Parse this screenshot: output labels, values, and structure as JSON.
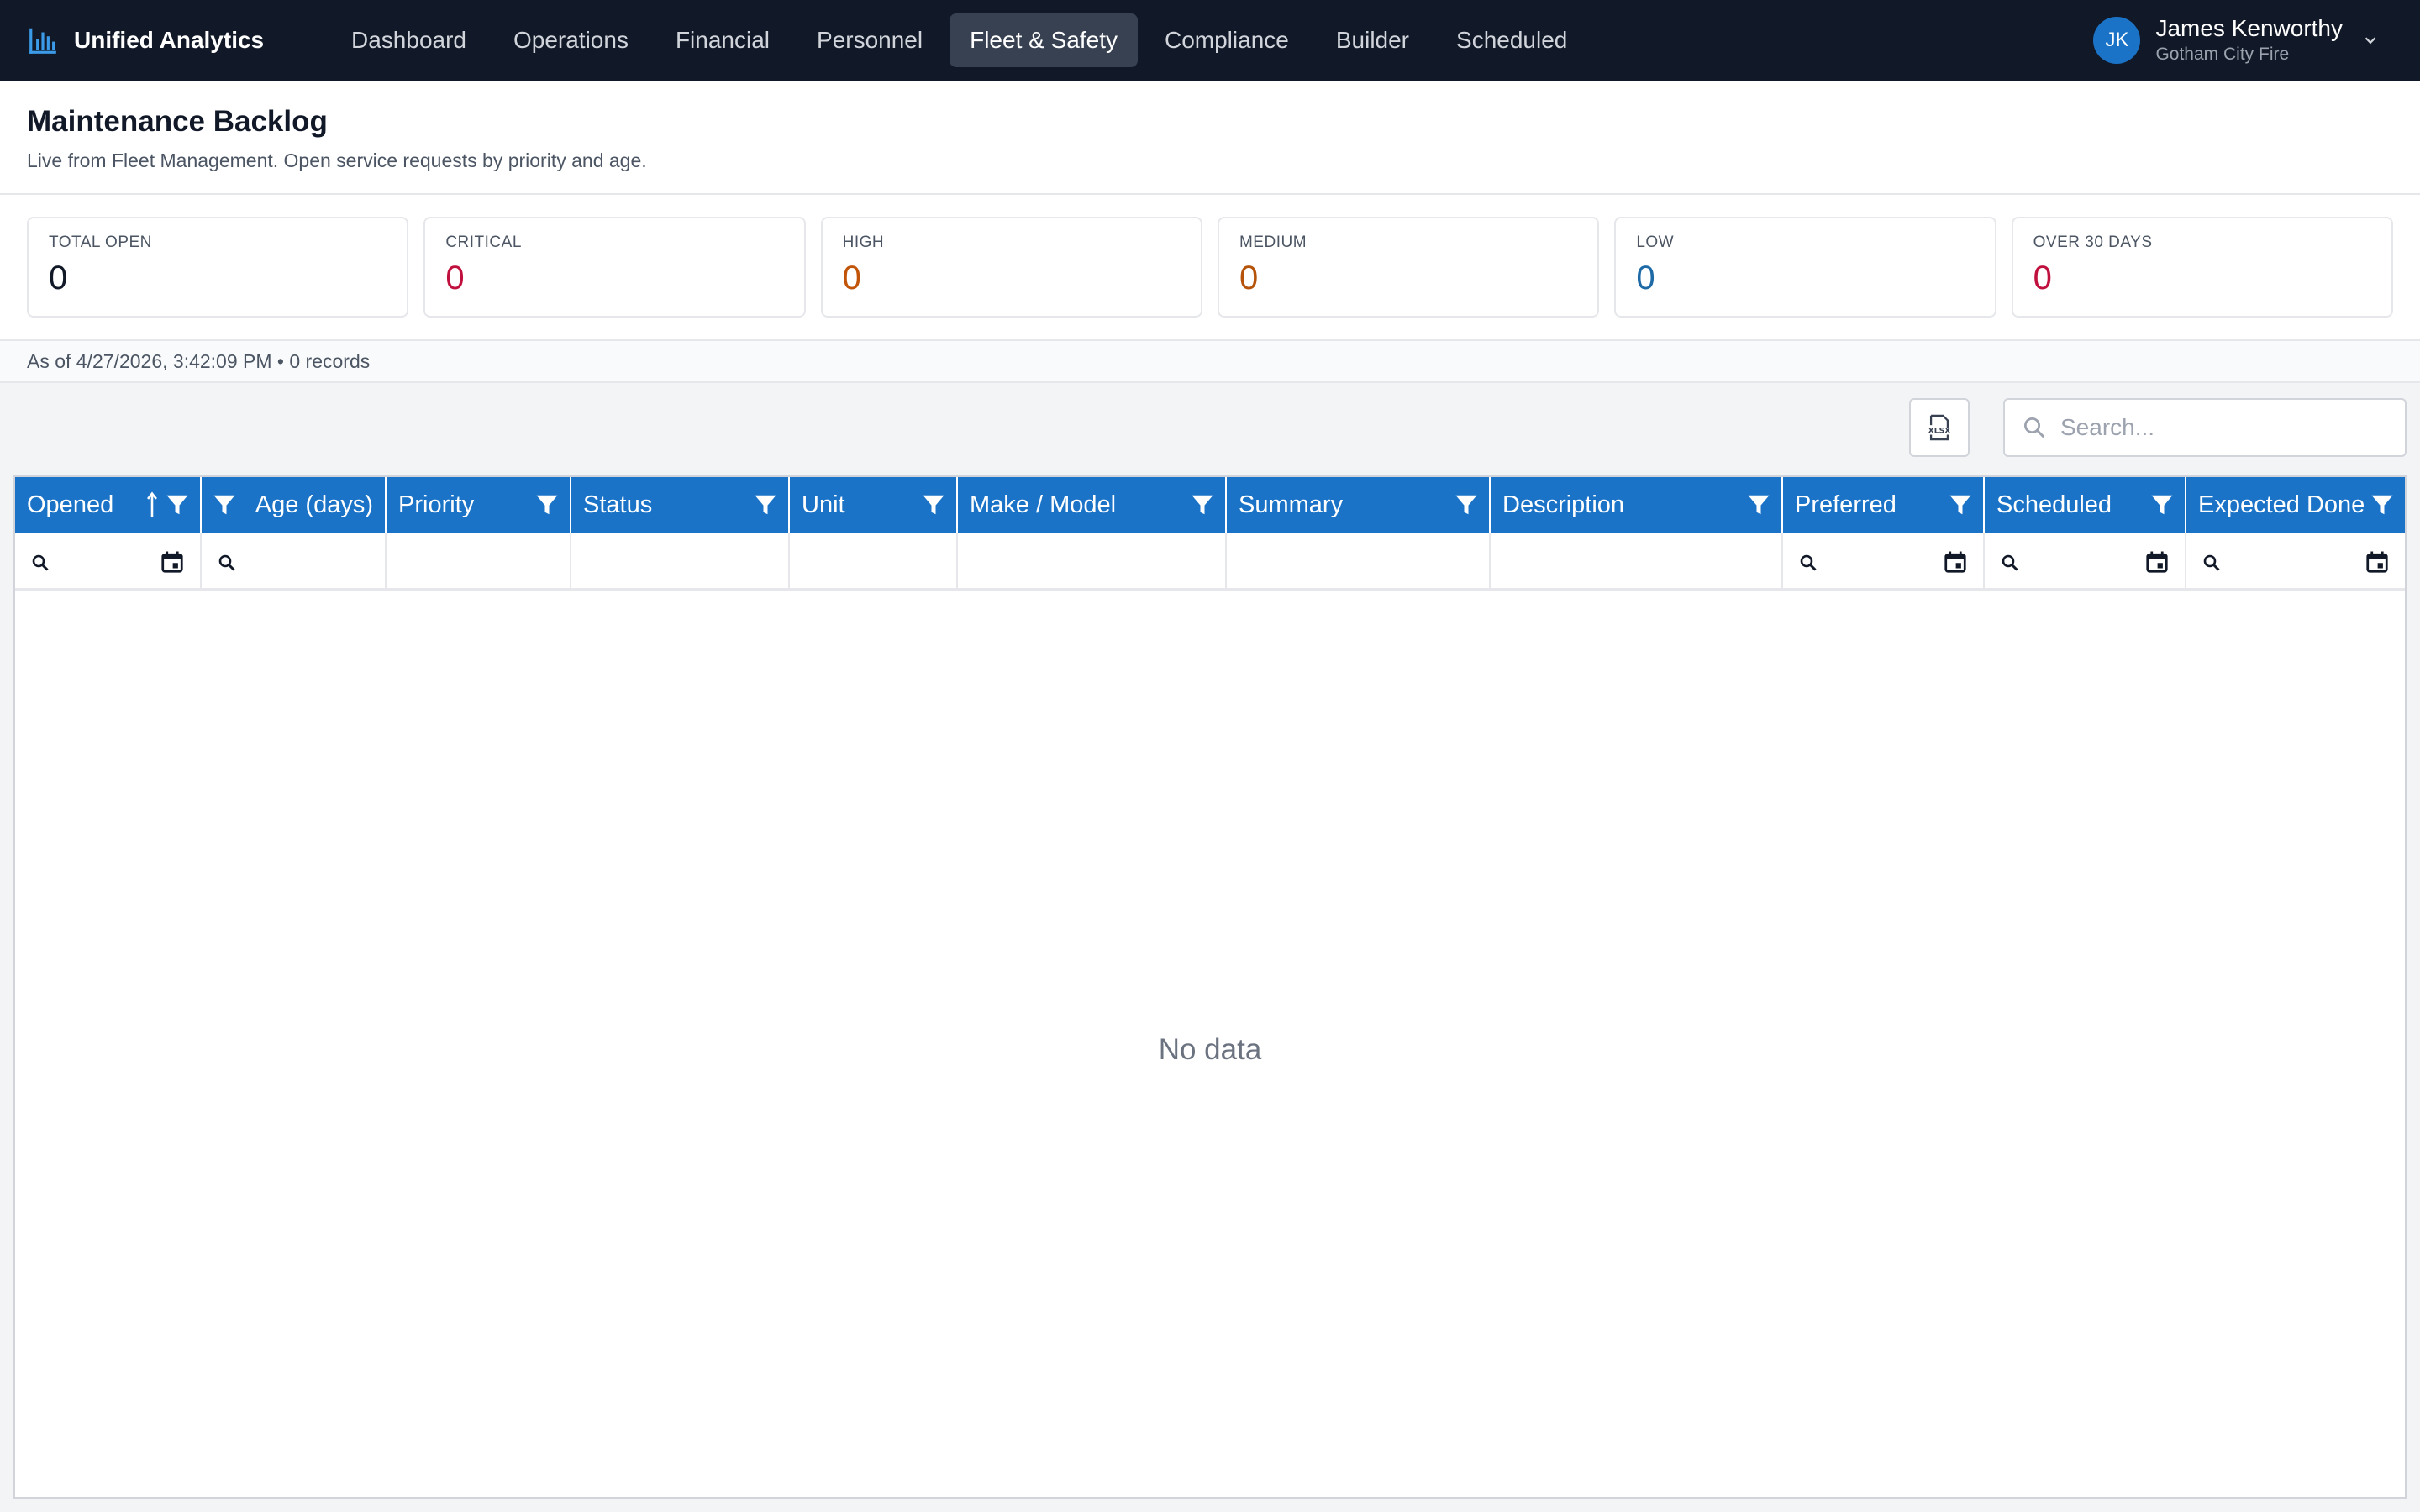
{
  "app": {
    "name": "Unified Analytics",
    "icon": "bar-chart-icon"
  },
  "nav": {
    "items": [
      {
        "label": "Dashboard",
        "active": false
      },
      {
        "label": "Operations",
        "active": false
      },
      {
        "label": "Financial",
        "active": false
      },
      {
        "label": "Personnel",
        "active": false
      },
      {
        "label": "Fleet & Safety",
        "active": true
      },
      {
        "label": "Compliance",
        "active": false
      },
      {
        "label": "Builder",
        "active": false
      },
      {
        "label": "Scheduled",
        "active": false
      }
    ]
  },
  "user": {
    "initials": "JK",
    "name": "James Kenworthy",
    "org": "Gotham City Fire"
  },
  "page": {
    "title": "Maintenance Backlog",
    "subtitle": "Live from Fleet Management. Open service requests by priority and age."
  },
  "kpis": [
    {
      "label": "TOTAL OPEN",
      "value": "0",
      "color": "#111827"
    },
    {
      "label": "CRITICAL",
      "value": "0",
      "color": "#c0103e"
    },
    {
      "label": "HIGH",
      "value": "0",
      "color": "#c2540a"
    },
    {
      "label": "MEDIUM",
      "value": "0",
      "color": "#b45309"
    },
    {
      "label": "LOW",
      "value": "0",
      "color": "#1d6aa6"
    },
    {
      "label": "OVER 30 DAYS",
      "value": "0",
      "color": "#c0103e"
    }
  ],
  "status": {
    "as_of": "As of 4/27/2026, 3:42:09 PM • 0 records"
  },
  "toolbar": {
    "export_icon": "xlsx-export-icon",
    "search_placeholder": "Search...",
    "search_value": ""
  },
  "grid": {
    "columns": [
      {
        "label": "Opened",
        "sorted": "ascending",
        "filter": "date"
      },
      {
        "label": "Age (days)",
        "filter": "text"
      },
      {
        "label": "Priority",
        "filter": "none"
      },
      {
        "label": "Status",
        "filter": "none"
      },
      {
        "label": "Unit",
        "filter": "none"
      },
      {
        "label": "Make / Model",
        "filter": "none"
      },
      {
        "label": "Summary",
        "filter": "none"
      },
      {
        "label": "Description",
        "filter": "none"
      },
      {
        "label": "Preferred",
        "filter": "date"
      },
      {
        "label": "Scheduled",
        "filter": "date"
      },
      {
        "label": "Expected Done",
        "filter": "date"
      }
    ],
    "rows": [],
    "empty_text": "No data"
  },
  "colors": {
    "nav_bg": "#111827",
    "accent": "#1a73c7",
    "header_bg": "#1a73c7"
  }
}
